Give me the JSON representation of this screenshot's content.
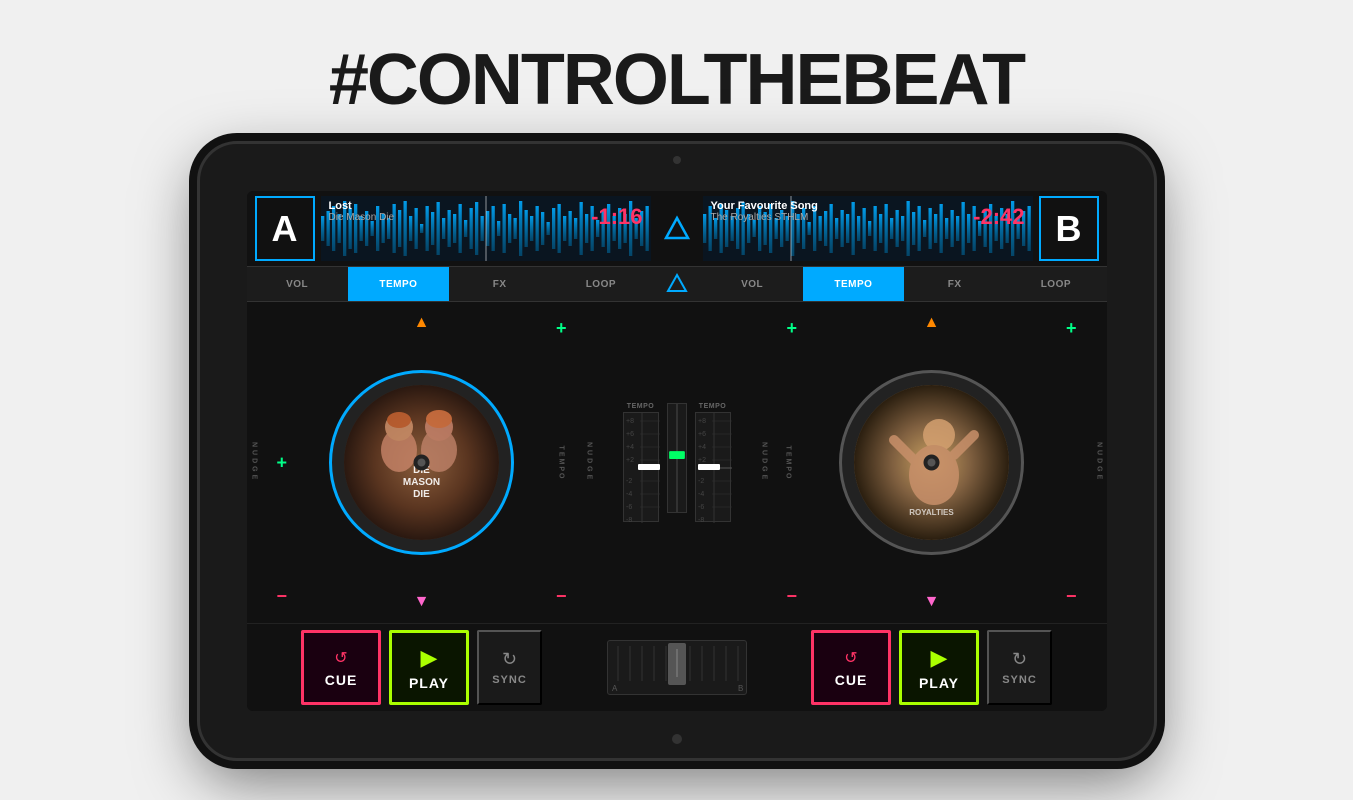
{
  "headline": "#CONTROLTHEBEAT",
  "deck_a": {
    "letter": "A",
    "track_title": "Lost",
    "track_artist": "Die Mason Die",
    "time": "-1:16",
    "label_text": "DIE\nMASON\nDIE"
  },
  "deck_b": {
    "letter": "B",
    "track_title": "Your Favourite Song",
    "track_artist": "The Royalties STHLM",
    "time": "-2:42"
  },
  "controls": {
    "vol": "VOL",
    "tempo": "TEMPO",
    "fx": "FX",
    "loop": "LOOP"
  },
  "buttons": {
    "cue": "CUE",
    "play": "PLAY",
    "sync": "SYNC"
  },
  "tempo_values": [
    "+8",
    "+6",
    "+4",
    "+2",
    "0",
    "-2",
    "-4",
    "-6",
    "-8"
  ],
  "mixer": {
    "crossfader_a": "A",
    "crossfader_b": "B"
  }
}
